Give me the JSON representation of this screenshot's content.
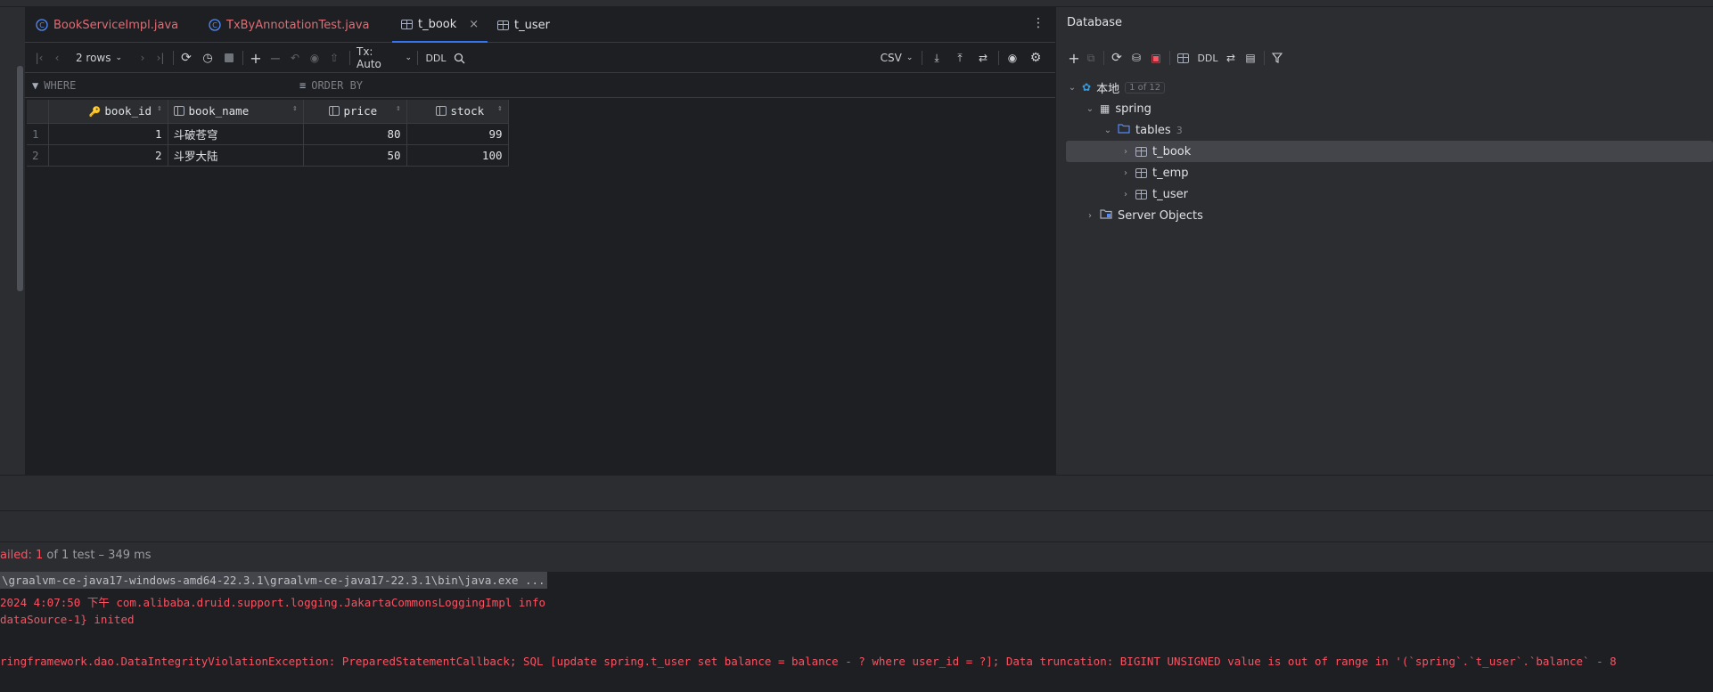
{
  "tabs": [
    {
      "label": "BookServiceImpl.java",
      "kind": "java"
    },
    {
      "label": "TxByAnnotationTest.java",
      "kind": "java"
    },
    {
      "label": "t_book",
      "kind": "table",
      "active": true
    },
    {
      "label": "t_user",
      "kind": "table"
    }
  ],
  "toolbar": {
    "rows": "2 rows",
    "tx": "Tx: Auto",
    "ddl": "DDL",
    "export_format": "CSV"
  },
  "filter": {
    "where": "WHERE",
    "order_by": "ORDER BY"
  },
  "grid": {
    "columns": [
      "book_id",
      "book_name",
      "price",
      "stock"
    ],
    "rows": [
      {
        "num": "1",
        "book_id": "1",
        "book_name": "斗破苍穹",
        "price": "80",
        "stock": "99"
      },
      {
        "num": "2",
        "book_id": "2",
        "book_name": "斗罗大陆",
        "price": "50",
        "stock": "100"
      }
    ]
  },
  "db": {
    "title": "Database",
    "ddl": "DDL",
    "tree": {
      "root": "本地",
      "root_badge": "1 of 12",
      "schema": "spring",
      "tables_label": "tables",
      "tables_count": "3",
      "tables": [
        "t_book",
        "t_emp",
        "t_user"
      ],
      "server_objects": "Server Objects"
    }
  },
  "test": {
    "failed_prefix": "ailed:",
    "failed_count": "1",
    "rest": "of 1 test – 349 ms"
  },
  "console": {
    "line1": "\\graalvm-ce-java17-windows-amd64-22.3.1\\graalvm-ce-java17-22.3.1\\bin\\java.exe ...",
    "line2": " 2024 4:07:50 下午 com.alibaba.druid.support.logging.JakartaCommonsLoggingImpl info",
    "line3": "dataSource-1} inited",
    "line4": "ringframework.dao.DataIntegrityViolationException: PreparedStatementCallback; SQL [update spring.t_user set balance = balance - ? where user_id = ?]; Data truncation: BIGINT UNSIGNED value is out of range in '(`spring`.`t_user`.`balance` - 8"
  },
  "colors": {
    "accent": "#3574f0",
    "error": "#f75464",
    "background": "#1e1f22",
    "panel": "#2b2d30"
  }
}
